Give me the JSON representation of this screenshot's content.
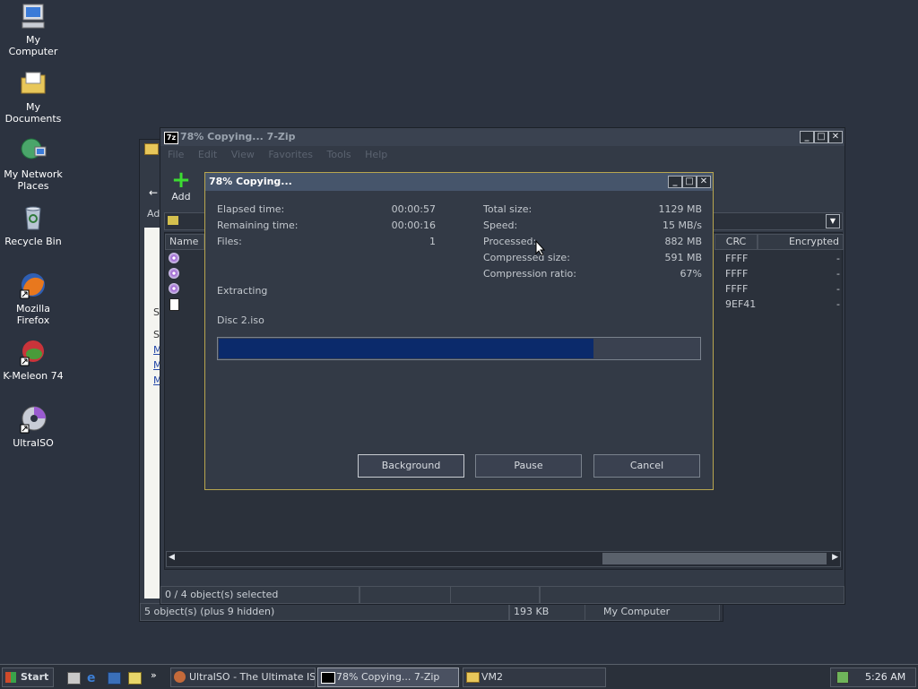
{
  "desktop": {
    "icons": [
      {
        "label": "My Computer",
        "icon": "my-computer-icon"
      },
      {
        "label": "My Documents",
        "icon": "my-documents-icon"
      },
      {
        "label": "My Network\nPlaces",
        "icon": "network-places-icon"
      },
      {
        "label": "Recycle Bin",
        "icon": "recycle-bin-icon"
      },
      {
        "label": "Mozilla Firefox",
        "icon": "firefox-icon"
      },
      {
        "label": "K-Meleon 74",
        "icon": "k-meleon-icon"
      },
      {
        "label": "UltraISO",
        "icon": "ultraiso-icon"
      }
    ]
  },
  "back_window": {
    "status_left": "5 object(s) (plus 9 hidden)",
    "status_size": "193 KB",
    "status_location": "My Computer",
    "side_text": [
      "Ad",
      "S",
      "S",
      "M",
      "M",
      "M"
    ]
  },
  "zip_window": {
    "title": "78% Copying... 7-Zip",
    "menu": [
      "File",
      "Edit",
      "View",
      "Favorites",
      "Tools",
      "Help"
    ],
    "toolbar_add": "Add",
    "columns": {
      "name": "Name",
      "crc": "CRC",
      "encrypted": "Encrypted"
    },
    "rows": [
      {
        "crc": "FFFF",
        "enc": "-"
      },
      {
        "crc": "FFFF",
        "enc": "-"
      },
      {
        "crc": "FFFF",
        "enc": "-"
      },
      {
        "crc": "9EF41",
        "enc": "-"
      }
    ],
    "status": "0 / 4 object(s) selected"
  },
  "dialog": {
    "title": "78% Copying...",
    "elapsed_label": "Elapsed time:",
    "elapsed_value": "00:00:57",
    "remaining_label": "Remaining time:",
    "remaining_value": "00:00:16",
    "files_label": "Files:",
    "files_value": "1",
    "total_label": "Total size:",
    "total_value": "1129 MB",
    "speed_label": "Speed:",
    "speed_value": "15 MB/s",
    "processed_label": "Processed:",
    "processed_value": "882 MB",
    "compressed_label": "Compressed size:",
    "compressed_value": "591 MB",
    "ratio_label": "Compression ratio:",
    "ratio_value": "67%",
    "operation": "Extracting",
    "current_file": "Disc 2.iso",
    "progress": 0.78,
    "background_button": "Background",
    "pause_button": "Pause",
    "cancel_button": "Cancel"
  },
  "taskbar": {
    "start": "Start",
    "tasks": [
      "UltraISO - The Ultimate IS...",
      "78% Copying... 7-Zip",
      "VM2"
    ],
    "clock": "5:26 AM"
  },
  "colors": {
    "accent": "#0b2a6b",
    "dialog_border": "#b8a64f"
  }
}
